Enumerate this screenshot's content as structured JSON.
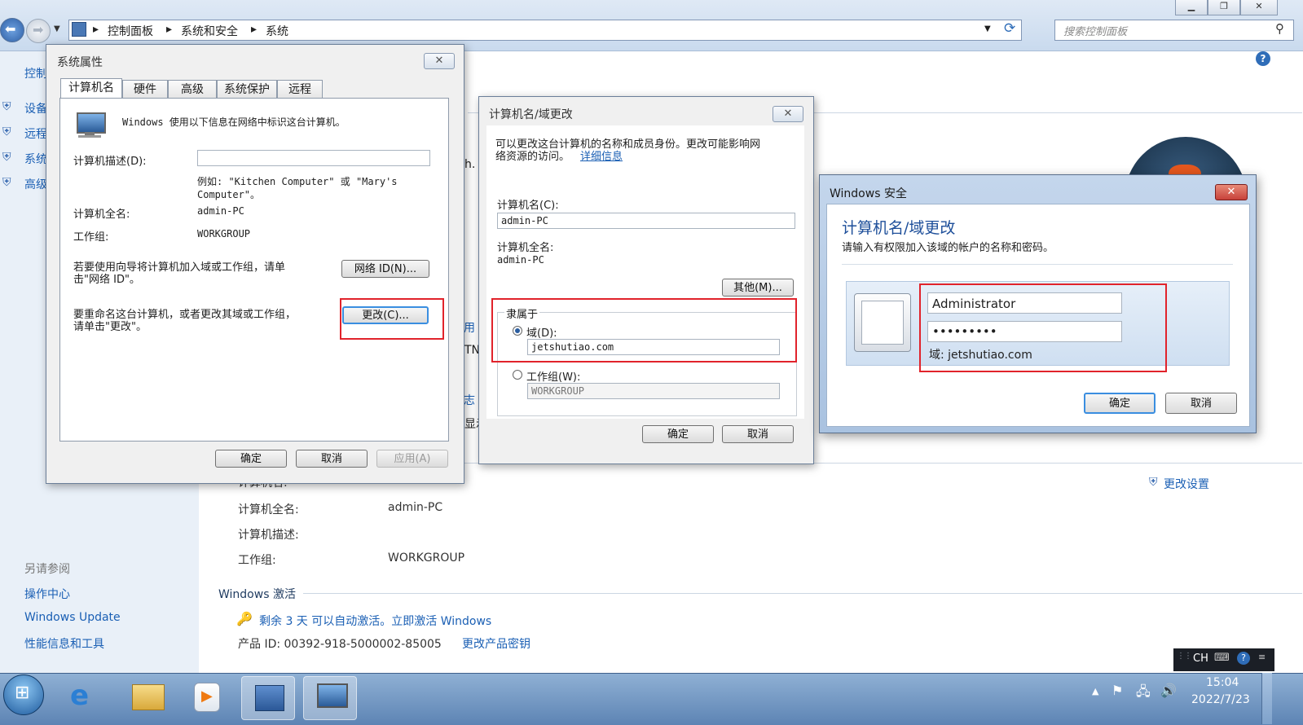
{
  "explorer": {
    "breadcrumb": [
      "控制面板",
      "系统和安全",
      "系统"
    ],
    "search_placeholder": "搜索控制面板",
    "left_panel": {
      "truncated_items": [
        "控制",
        "设备",
        "远程",
        "系统",
        "高级"
      ],
      "see_also_title": "另请参阅",
      "see_also": [
        "操作中心",
        "Windows Update",
        "性能信息和工具"
      ]
    },
    "main": {
      "partial_fragments": [
        "h.",
        "用",
        "TN",
        "志",
        "显示"
      ],
      "computer_name_cut": "计算机名:",
      "computer_name_cut_value": "admin-PC",
      "full_name_label": "计算机全名:",
      "full_name_value": "admin-PC",
      "desc_label": "计算机描述:",
      "desc_value": "",
      "workgroup_label": "工作组:",
      "workgroup_value": "WORKGROUP",
      "change_settings": "更改设置",
      "activation_title": "Windows 激活",
      "activation_text": "剩余 3 天 可以自动激活。立即激活 Windows",
      "product_id_label": "产品 ID: 00392-918-5000002-85005",
      "change_key": "更改产品密钥"
    }
  },
  "sysprops": {
    "title": "系统属性",
    "tabs": [
      "计算机名",
      "硬件",
      "高级",
      "系统保护",
      "远程"
    ],
    "intro": "Windows 使用以下信息在网络中标识这台计算机。",
    "desc_label": "计算机描述(D):",
    "desc_value": "",
    "example_line1": "例如: \"Kitchen Computer\" 或 \"Mary's",
    "example_line2": "Computer\"。",
    "full_name_label": "计算机全名:",
    "full_name_value": "admin-PC",
    "workgroup_label": "工作组:",
    "workgroup_value": "WORKGROUP",
    "wizard_line1": "若要使用向导将计算机加入域或工作组，请单",
    "wizard_line2": "击\"网络 ID\"。",
    "network_id_btn": "网络 ID(N)...",
    "rename_line1": "要重命名这台计算机，或者更改其域或工作组，",
    "rename_line2": "请单击\"更改\"。",
    "change_btn": "更改(C)...",
    "ok": "确定",
    "cancel": "取消",
    "apply": "应用(A)"
  },
  "domainchange": {
    "title": "计算机名/域更改",
    "intro_line1": "可以更改这台计算机的名称和成员身份。更改可能影响网",
    "intro_line2": "络资源的访问。",
    "details_link": "详细信息",
    "name_label": "计算机名(C):",
    "name_value": "admin-PC",
    "full_name_label": "计算机全名:",
    "full_name_value": "admin-PC",
    "more_btn": "其他(M)...",
    "member_of": "隶属于",
    "domain_label": "域(D):",
    "domain_value": "jetshutiao.com",
    "workgroup_label": "工作组(W):",
    "workgroup_value": "WORKGROUP",
    "ok": "确定",
    "cancel": "取消"
  },
  "security": {
    "title": "Windows 安全",
    "heading": "计算机名/域更改",
    "subtitle": "请输入有权限加入该域的帐户的名称和密码。",
    "username_value": "Administrator",
    "password_value": "•••••••••",
    "domain_text": "域: jetshutiao.com",
    "ok": "确定",
    "cancel": "取消"
  },
  "taskbar": {
    "lang": "CH",
    "time": "15:04",
    "date": "2022/7/23"
  },
  "colors": {
    "highlight_red": "#e1232b",
    "link_blue": "#1a5fb4",
    "close_red": "#c7423a"
  }
}
